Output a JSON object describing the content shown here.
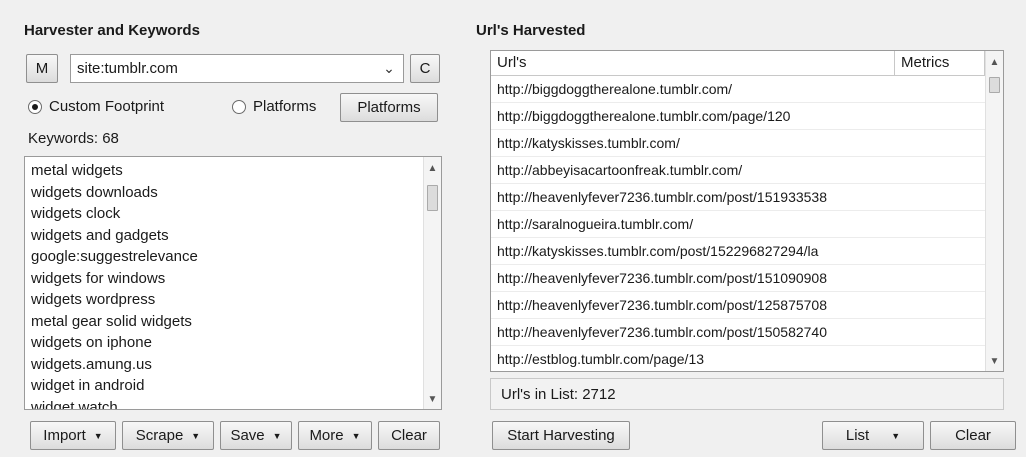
{
  "harvester": {
    "title": "Harvester and Keywords",
    "m_button": "M",
    "footprint_value": "site:tumblr.com",
    "c_button": "C",
    "custom_footprint_label": "Custom Footprint",
    "platforms_radio_label": "Platforms",
    "platforms_button": "Platforms",
    "keywords_label": "Keywords:",
    "keywords_count": "68",
    "keywords": [
      "metal widgets",
      "widgets downloads",
      "widgets clock",
      "widgets and gadgets",
      "google:suggestrelevance",
      "widgets for windows",
      "widgets wordpress",
      "metal gear solid widgets",
      "widgets on iphone",
      "widgets.amung.us",
      "widget in android",
      "widget watch"
    ],
    "toolbar": {
      "import": "Import",
      "scrape": "Scrape",
      "save": "Save",
      "more": "More",
      "clear": "Clear"
    }
  },
  "urls": {
    "title": "Url's Harvested",
    "columns": [
      "Url's",
      "Metrics"
    ],
    "rows": [
      "http://biggdoggtherealone.tumblr.com/",
      "http://biggdoggtherealone.tumblr.com/page/120",
      "http://katyskisses.tumblr.com/",
      "http://abbeyisacartoonfreak.tumblr.com/",
      "http://heavenlyfever7236.tumblr.com/post/151933538",
      "http://saralnogueira.tumblr.com/",
      "http://katyskisses.tumblr.com/post/152296827294/la",
      "http://heavenlyfever7236.tumblr.com/post/151090908",
      "http://heavenlyfever7236.tumblr.com/post/125875708",
      "http://heavenlyfever7236.tumblr.com/post/150582740",
      "http://estblog.tumblr.com/page/13"
    ],
    "status_label": "Url's in List:",
    "status_count": "2712",
    "start_button": "Start Harvesting",
    "list_button": "List",
    "clear_button": "Clear"
  }
}
